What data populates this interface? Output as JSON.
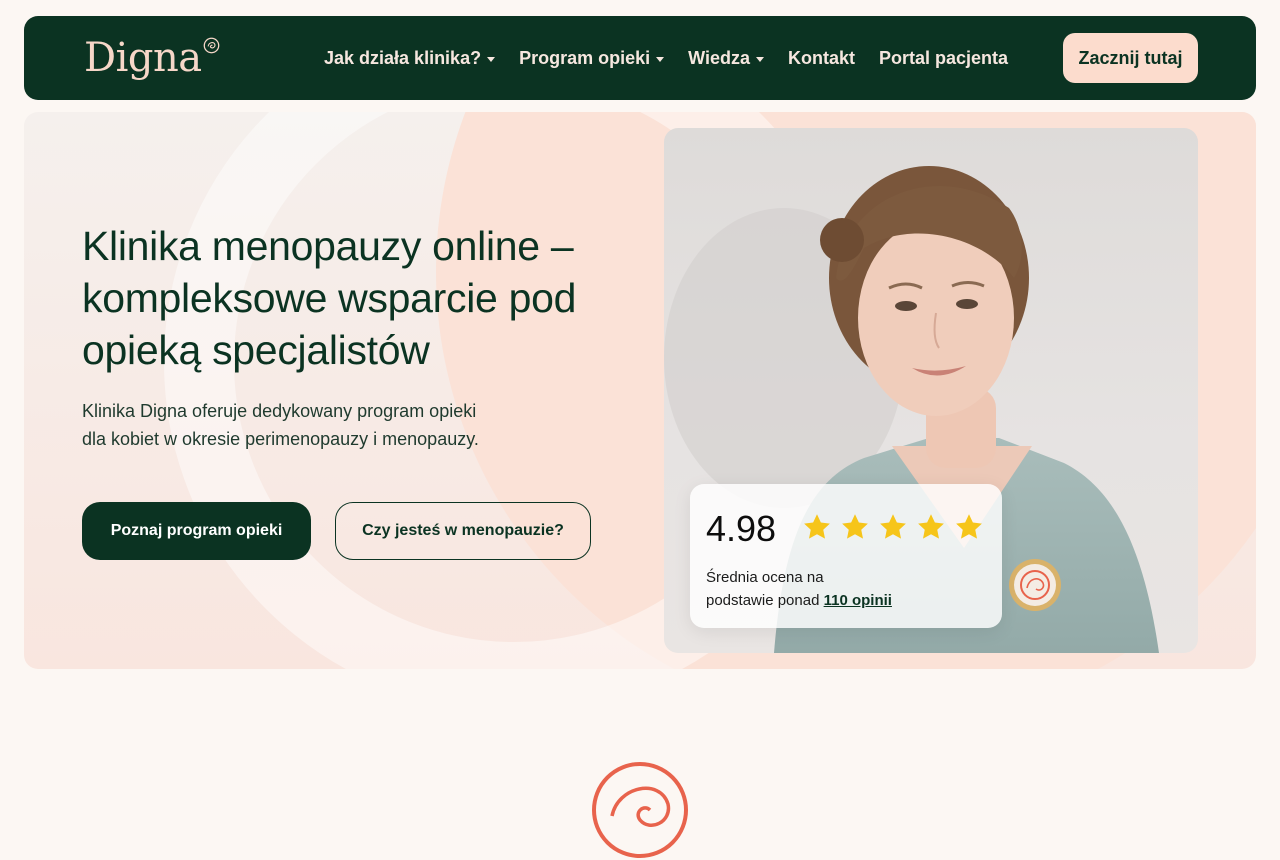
{
  "header": {
    "logo": "Digna",
    "nav": [
      {
        "label": "Jak działa klinika?",
        "dropdown": true
      },
      {
        "label": "Program opieki",
        "dropdown": true
      },
      {
        "label": "Wiedza",
        "dropdown": true
      },
      {
        "label": "Kontakt",
        "dropdown": false
      },
      {
        "label": "Portal pacjenta",
        "dropdown": false
      }
    ],
    "cta": "Zacznij tutaj"
  },
  "hero": {
    "title": "Klinika menopauzy online – kompleksowe wsparcie pod opieką specjalistów",
    "description_line1": "Klinika Digna oferuje dedykowany program opieki",
    "description_line2": "dla kobiet w okresie perimenopauzy i menopauzy.",
    "primary_button": "Poznaj program opieki",
    "secondary_button": "Czy jesteś w menopauzie?"
  },
  "rating": {
    "value": "4.98",
    "stars": 5,
    "text_line1": "Średnia ocena na",
    "text_line2_prefix": "podstawie ponad ",
    "link": "110 opinii"
  },
  "colors": {
    "primary": "#0b3322",
    "accent_peach": "#fcdccd",
    "star": "#f6c51a",
    "brand_coral": "#e8634c"
  },
  "icons": [
    "digna-logo-mark",
    "caret-down-icon",
    "star-icon",
    "digna-badge-icon"
  ]
}
